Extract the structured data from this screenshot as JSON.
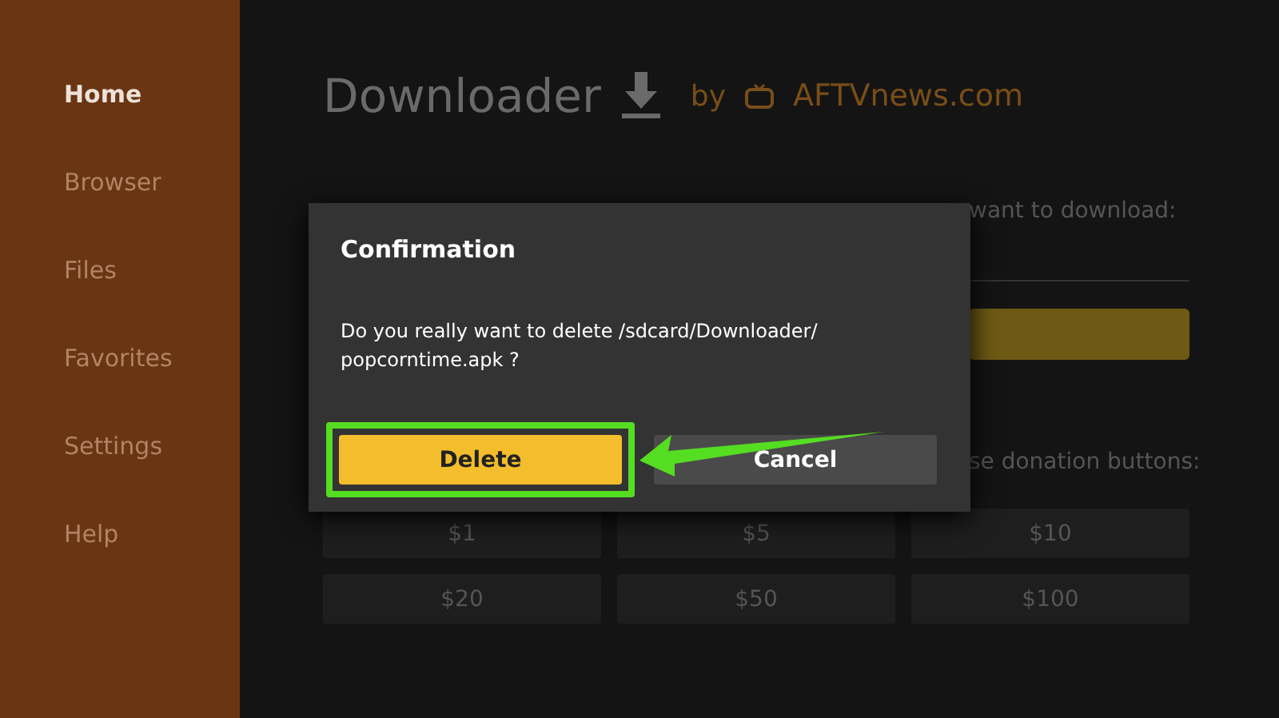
{
  "sidebar": {
    "items": [
      {
        "label": "Home",
        "selected": true
      },
      {
        "label": "Browser",
        "selected": false
      },
      {
        "label": "Files",
        "selected": false
      },
      {
        "label": "Favorites",
        "selected": false
      },
      {
        "label": "Settings",
        "selected": false
      },
      {
        "label": "Help",
        "selected": false
      }
    ]
  },
  "header": {
    "title": "Downloader",
    "by": "by",
    "brand": "AFTVnews.com"
  },
  "url_prompt": "want to download:",
  "donation_prompt": "se donation buttons:",
  "donations": [
    "$1",
    "$5",
    "$10",
    "$20",
    "$50",
    "$100"
  ],
  "dialog": {
    "title": "Confirmation",
    "message": "Do you really want to delete /sdcard/Downloader/ popcorntime.apk ?",
    "buttons": [
      {
        "label": "Delete",
        "kind": "primary",
        "highlighted": true
      },
      {
        "label": "Cancel",
        "kind": "secondary",
        "highlighted": false
      }
    ]
  }
}
